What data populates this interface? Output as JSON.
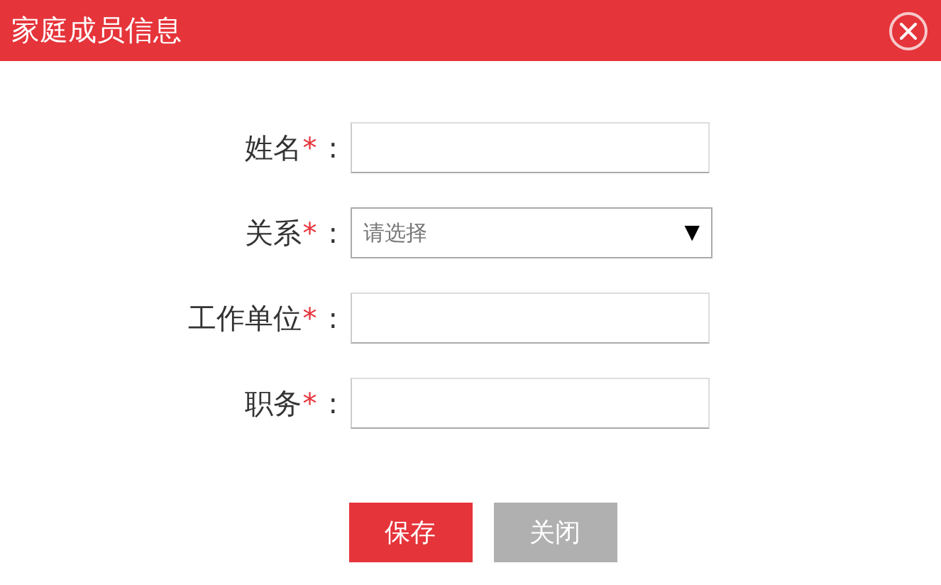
{
  "window": {
    "title": "家庭成员信息"
  },
  "fields": [
    {
      "kind": "text",
      "label": "姓名",
      "required_mark": "*",
      "colon": ":"
    },
    {
      "kind": "select",
      "label": "关系",
      "required_mark": "*",
      "colon": ":",
      "placeholder": "请选择",
      "arrow": "▼"
    },
    {
      "kind": "text",
      "label": "工作单位",
      "required_mark": "*",
      "colon": ":"
    },
    {
      "kind": "text",
      "label": "职务",
      "required_mark": "*",
      "colon": ":"
    }
  ],
  "buttons": [
    {
      "kind": "primary",
      "label": "保存"
    },
    {
      "kind": "secondary",
      "label": "关闭"
    }
  ]
}
